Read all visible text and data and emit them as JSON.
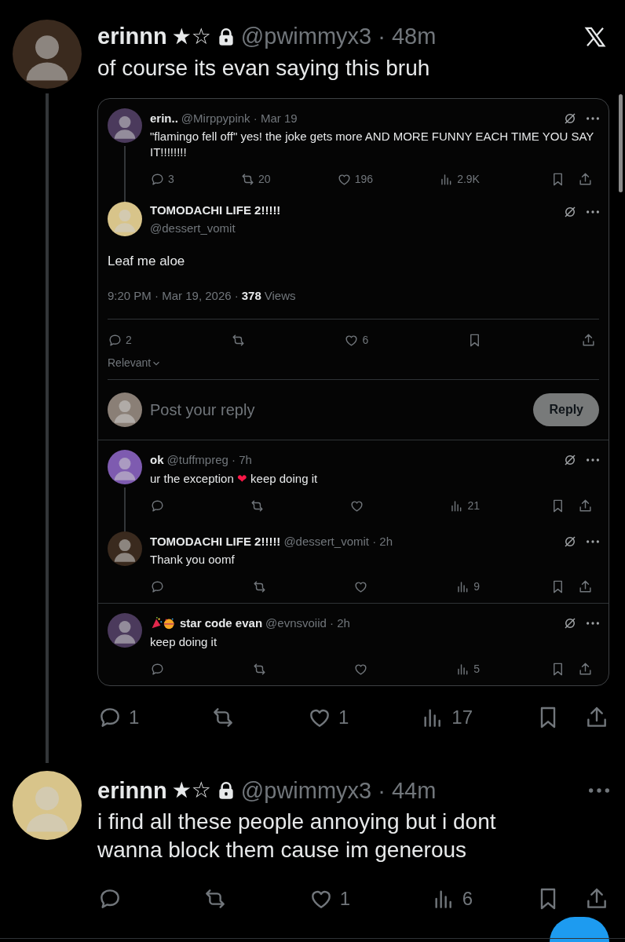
{
  "posts": [
    {
      "name": "erinnn",
      "badges": "★☆",
      "meta": "@pwimmyx3 · 48m",
      "text": "of course its evan saying this bruh",
      "thread_line": true,
      "quote": {
        "parent": {
          "name": "erin..",
          "meta": "@Mirppypink · Mar 19",
          "text": "\"flamingo fell off\" yes! the joke gets more AND MORE FUNNY EACH TIME YOU SAY IT!!!!!!!!",
          "actions": [
            {
              "kind": "reply",
              "count": "3"
            },
            {
              "kind": "repost",
              "count": "20"
            },
            {
              "kind": "like",
              "count": "196"
            },
            {
              "kind": "views",
              "count": "2.9K"
            },
            {
              "kind": "bookmark"
            },
            {
              "kind": "share"
            }
          ]
        },
        "focus": {
          "name": "TOMODACHI LIFE 2!!!!!",
          "handle": "@dessert_vomit",
          "text": "Leaf me aloe",
          "timestamp": "9:20 PM · Mar 19, 2026 ·",
          "views_count": "378",
          "views_label": "Views",
          "actions": [
            {
              "kind": "reply",
              "count": "2"
            },
            {
              "kind": "repost"
            },
            {
              "kind": "like",
              "count": "6"
            },
            {
              "kind": "bookmark"
            },
            {
              "kind": "share"
            }
          ]
        },
        "sort": "Relevant",
        "composer": {
          "placeholder": "Post your reply",
          "button": "Reply"
        },
        "replies": [
          {
            "name": "ok",
            "meta": "@tuffmpreg · 7h",
            "text": "ur the exception ❤ keep doing it",
            "thread_line": true,
            "actions": [
              {
                "kind": "reply"
              },
              {
                "kind": "repost"
              },
              {
                "kind": "like"
              },
              {
                "kind": "views",
                "count": "21"
              },
              {
                "kind": "bookmark"
              },
              {
                "kind": "share"
              }
            ]
          },
          {
            "name": "TOMODACHI LIFE 2!!!!!",
            "meta": "@dessert_vomit · 2h",
            "text": "Thank you oomf",
            "thread_line": false,
            "actions": [
              {
                "kind": "reply"
              },
              {
                "kind": "repost"
              },
              {
                "kind": "like"
              },
              {
                "kind": "views",
                "count": "9"
              },
              {
                "kind": "bookmark"
              },
              {
                "kind": "share"
              }
            ]
          },
          {
            "name": "star code evan",
            "emoji_prefix": true,
            "meta": "@evnsvoiid · 2h",
            "text": "keep doing it",
            "thread_line": false,
            "actions": [
              {
                "kind": "reply"
              },
              {
                "kind": "repost"
              },
              {
                "kind": "like"
              },
              {
                "kind": "views",
                "count": "5"
              },
              {
                "kind": "bookmark"
              },
              {
                "kind": "share"
              }
            ]
          }
        ]
      },
      "actions": [
        {
          "kind": "reply",
          "count": "1"
        },
        {
          "kind": "repost"
        },
        {
          "kind": "like",
          "count": "1"
        },
        {
          "kind": "views",
          "count": "17"
        },
        {
          "kind": "bookmark"
        },
        {
          "kind": "share"
        }
      ]
    },
    {
      "name": "erinnn",
      "badges": "★☆",
      "meta": "@pwimmyx3 · 44m",
      "text": "i find all these people annoying but i dont wanna block them cause im generous",
      "thread_line": false,
      "actions": [
        {
          "kind": "reply"
        },
        {
          "kind": "repost"
        },
        {
          "kind": "like",
          "count": "1"
        },
        {
          "kind": "views",
          "count": "6"
        },
        {
          "kind": "bookmark"
        },
        {
          "kind": "share"
        }
      ]
    }
  ]
}
